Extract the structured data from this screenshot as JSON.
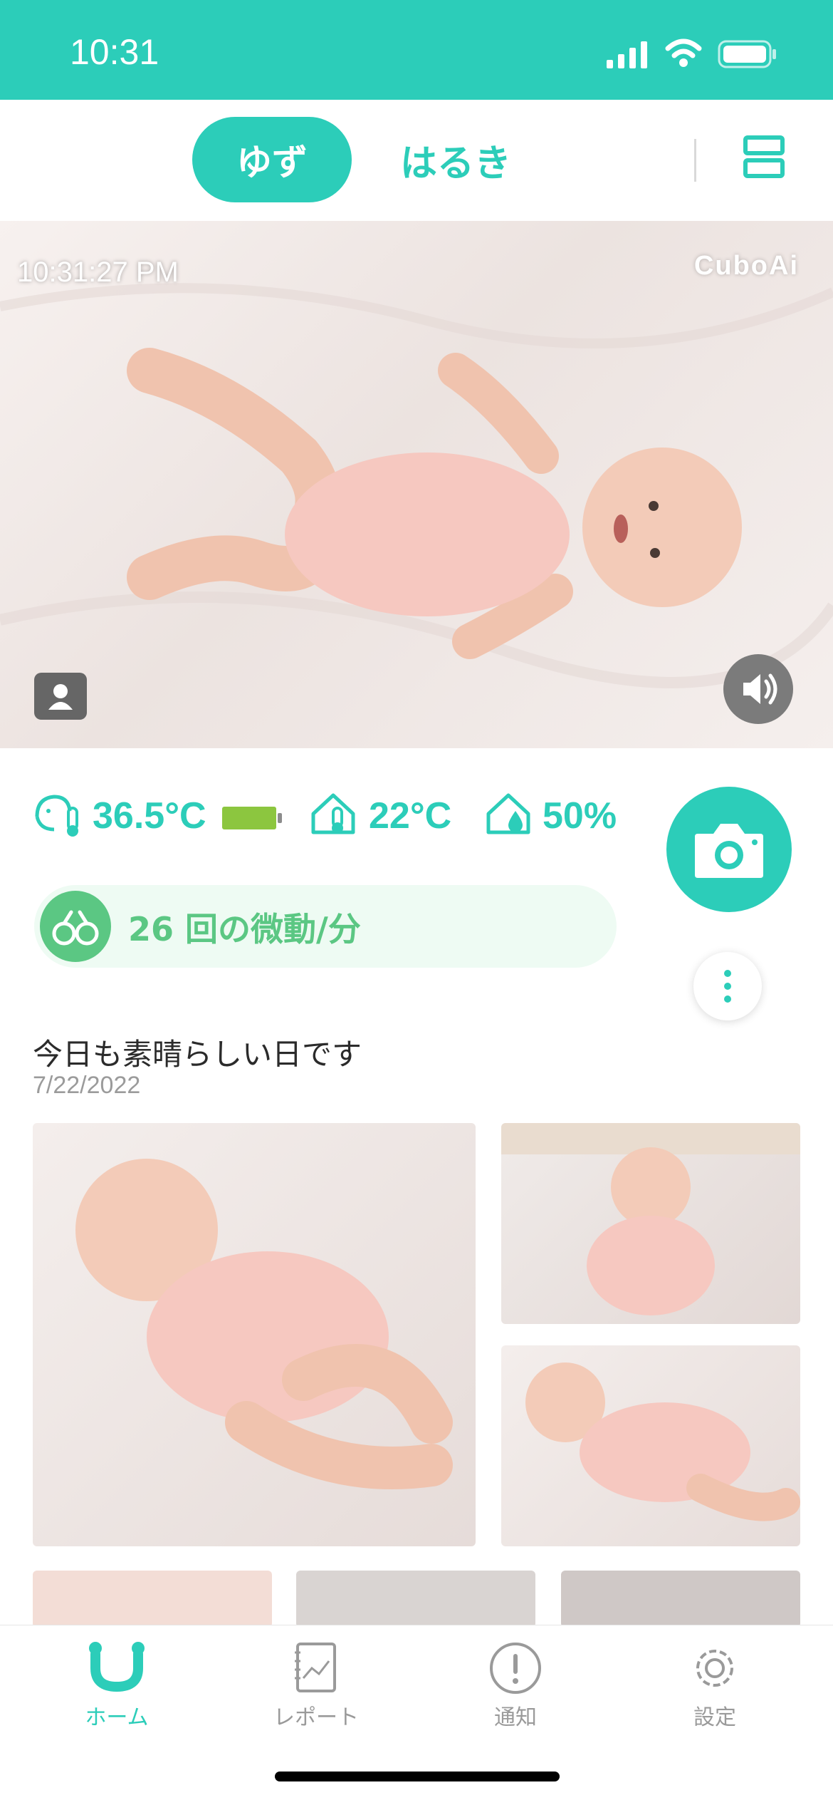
{
  "status_bar": {
    "time": "10:31"
  },
  "header": {
    "active_tab": "ゆず",
    "other_tab": "はるき"
  },
  "camera": {
    "timestamp": "10:31:27 PM",
    "brand": "CuboAi"
  },
  "metrics": {
    "baby_temp": "36.5°C",
    "battery_level_percent": 100,
    "room_temp": "22°C",
    "humidity": "50%"
  },
  "motion": {
    "count": "26",
    "label": "回の微動/分"
  },
  "feed": {
    "headline": "今日も素晴らしい日です",
    "date": "7/22/2022"
  },
  "tabbar": {
    "items": [
      {
        "label": "ホーム",
        "icon": "home-icon"
      },
      {
        "label": "レポート",
        "icon": "report-icon"
      },
      {
        "label": "通知",
        "icon": "notification-icon"
      },
      {
        "label": "設定",
        "icon": "settings-icon"
      }
    ]
  },
  "colors": {
    "accent": "#2ccdb9",
    "motion_green": "#5bc783",
    "battery_green": "#8cc63f"
  }
}
